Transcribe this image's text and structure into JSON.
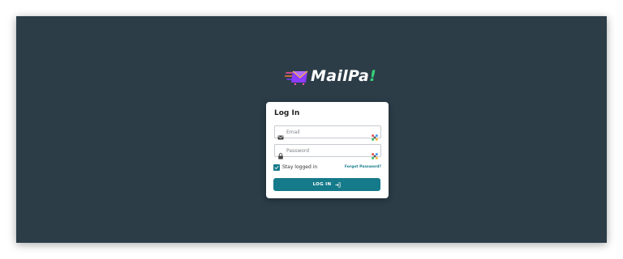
{
  "brand": {
    "name_main": "MailPa",
    "name_accent": "!"
  },
  "login": {
    "title": "Log In",
    "email": {
      "placeholder": "Email",
      "icon": "envelope-icon"
    },
    "password": {
      "placeholder": "Password",
      "icon": "lock-icon"
    },
    "extension_icon": "password-manager-icon",
    "stay_logged_in": {
      "label": "Stay logged in",
      "checked": true
    },
    "forgot_password": "Forgot Password?",
    "submit_label": "LOG IN",
    "submit_icon": "sign-in-icon"
  },
  "colors": {
    "background": "#2c3d48",
    "card": "#ffffff",
    "accent": "#157a8a",
    "brand_bang": "#34d27a"
  }
}
